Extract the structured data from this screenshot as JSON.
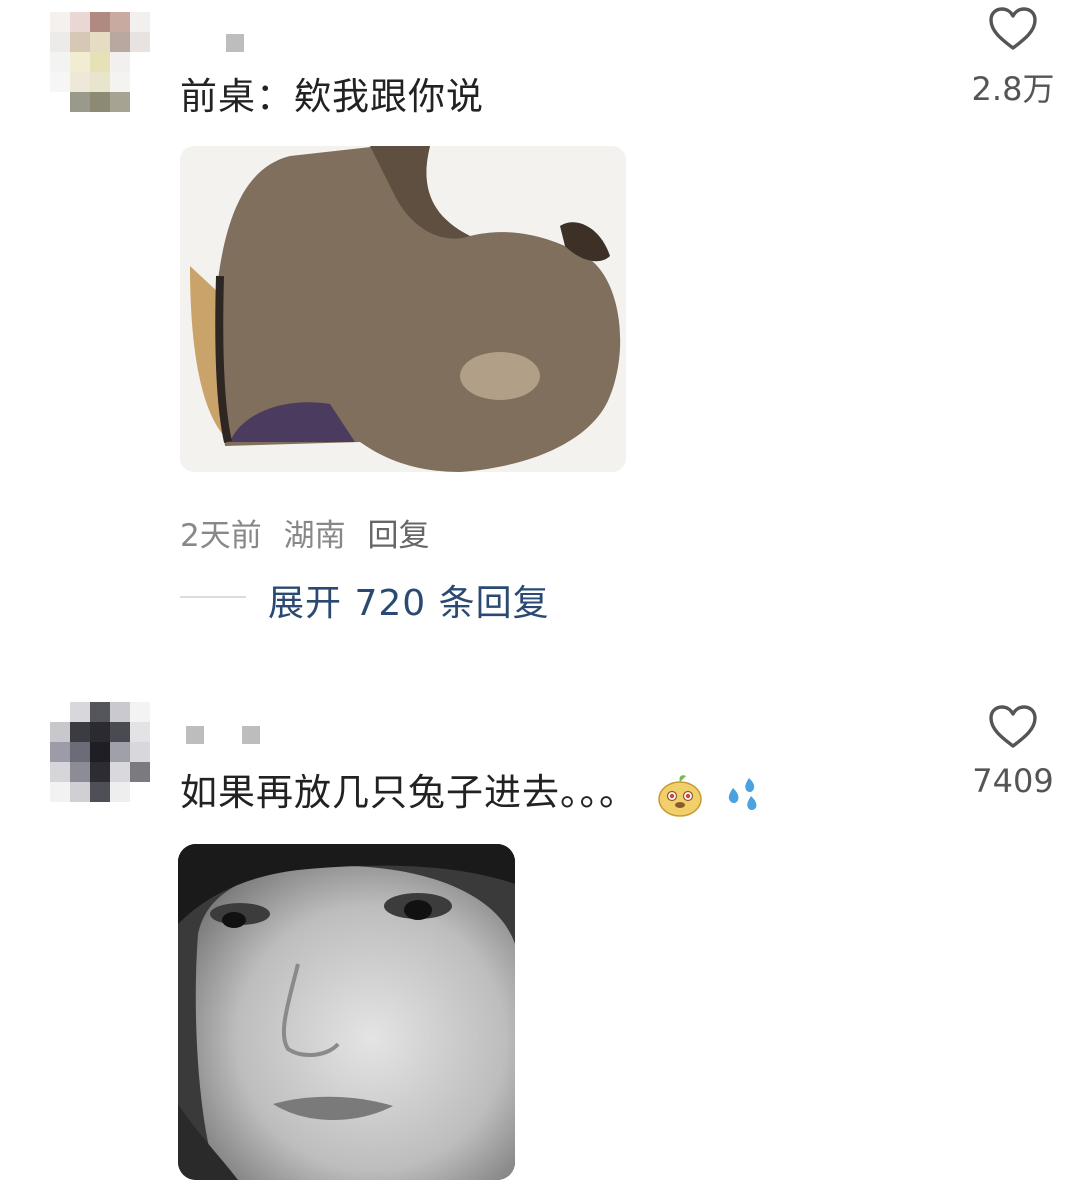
{
  "comments": [
    {
      "text": "前桌：欸我跟你说",
      "likes": "2.8万",
      "image_alt": "shoulder-photo",
      "meta": {
        "time": "2天前",
        "location": "湖南",
        "reply": "回复"
      },
      "expand_label": "展开 720 条回复"
    },
    {
      "text": "如果再放几只兔子进去。。。",
      "likes": "7409",
      "image_alt": "face-photo",
      "emojis": [
        "doge-fruit-emoji",
        "sweat-drops-emoji"
      ]
    }
  ],
  "colors": {
    "text": "#222222",
    "meta": "#888888",
    "link": "#2a4a73",
    "icon": "#555555"
  }
}
